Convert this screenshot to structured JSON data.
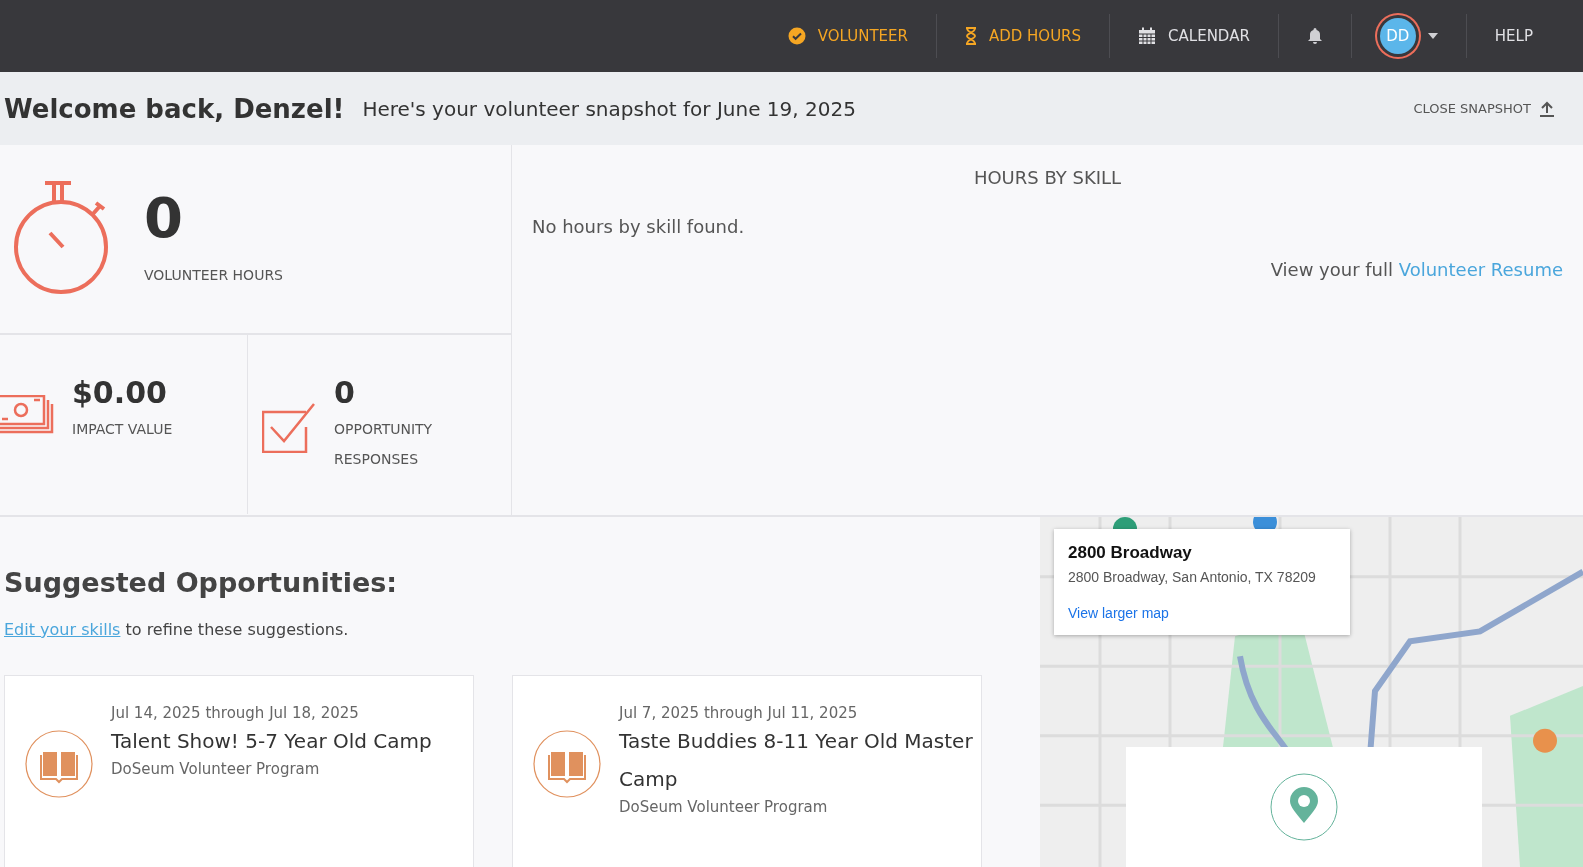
{
  "nav": [
    {
      "kind": "volunteer",
      "label": "VOLUNTEER",
      "highlighted": true
    },
    {
      "kind": "hours",
      "label": "ADD HOURS",
      "highlighted": true
    },
    {
      "kind": "calendar",
      "label": "CALENDAR",
      "highlighted": false
    },
    {
      "kind": "bell"
    },
    {
      "kind": "avatar",
      "initials": "DD"
    },
    {
      "kind": "plain",
      "label": "HELP",
      "highlighted": false
    }
  ],
  "welcome": {
    "title": "Welcome back, Denzel!",
    "subtitle": "Here's your volunteer snapshot for June 19, 2025",
    "close": "CLOSE SNAPSHOT"
  },
  "stats": [
    {
      "kind": "hours",
      "value": "0",
      "label": "VOLUNTEER HOURS"
    },
    {
      "kind": "money",
      "value": "$0.00",
      "label": "IMPACT VALUE"
    },
    {
      "kind": "check",
      "value": "0",
      "label": "OPPORTUNITY RESPONSES"
    }
  ],
  "skills": {
    "title": "HOURS BY SKILL",
    "empty": "No hours by skill found.",
    "resume_text": "View your full",
    "resume_link": "Volunteer Resume"
  },
  "suggested": {
    "title": "Suggested Opportunities:",
    "hint_link": "Edit your skills",
    "hint_text": "to refine these suggestions.",
    "cards": [
      {
        "dates": "Jul 14, 2025 through Jul 18, 2025",
        "title": "Talent Show! 5-7 Year Old Camp",
        "program": "DoSeum Volunteer Program"
      },
      {
        "dates": "Jul 7, 2025 through Jul 11, 2025",
        "title": "Taste Buddies 8-11 Year Old Master Camp",
        "program": "DoSeum Volunteer Program"
      }
    ]
  },
  "map": {
    "kind": "picture",
    "place_title": "2800 Broadway",
    "address": "2800 Broadway, San Antonio, TX 78209",
    "link": "View larger map"
  }
}
